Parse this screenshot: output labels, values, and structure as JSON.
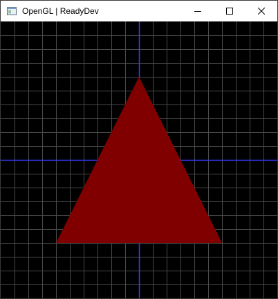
{
  "window": {
    "title": "OpenGL | ReadyDev",
    "icon": "app-window-icon",
    "controls": [
      "minimize-icon",
      "maximize-icon",
      "close-icon"
    ]
  },
  "scene": {
    "background_color": "#000000",
    "grid_color": "#4a4a4a",
    "grid_divisions": 20,
    "axis_color": "#3b3bff",
    "triangle": {
      "color": "#800000",
      "vertices_ndc": [
        [
          0.0,
          0.6
        ],
        [
          -0.6,
          -0.6
        ],
        [
          0.6,
          -0.6
        ]
      ]
    }
  }
}
